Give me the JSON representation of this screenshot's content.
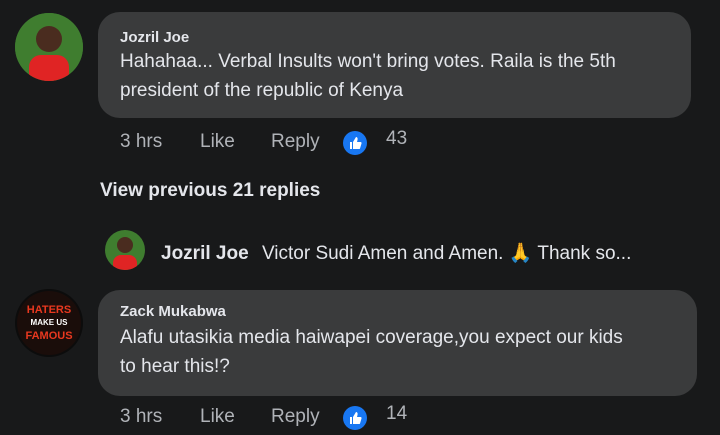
{
  "comments": [
    {
      "author": "Jozril Joe",
      "text_line1": "Hahahaa... Verbal Insults won't bring votes. Raila is the 5th",
      "text_line2": "president of the republic of Kenya",
      "time": "3 hrs",
      "like_label": "Like",
      "reply_label": "Reply",
      "reaction_count": "43"
    },
    {
      "author": "Zack Mukabwa",
      "avatar_lines": [
        "HATERS",
        "MAKE US",
        "FAMOUS"
      ],
      "text_line1": "Alafu utasikia media haiwapei coverage,you expect our kids",
      "text_line2": "to hear this!?",
      "time": "3 hrs",
      "like_label": "Like",
      "reply_label": "Reply",
      "reaction_count": "14"
    }
  ],
  "view_previous": "View previous 21 replies",
  "reply_preview": {
    "author": "Jozril Joe",
    "text": "Victor Sudi Amen and Amen.",
    "emoji": "🙏",
    "trail": "Thank so..."
  },
  "colors": {
    "background": "#18191a",
    "bubble": "#3a3b3c",
    "like_blue": "#1877f2",
    "meta_gray": "#b0b3b8"
  },
  "icons": [
    "thumbs-up-icon",
    "praying-hands-icon"
  ]
}
